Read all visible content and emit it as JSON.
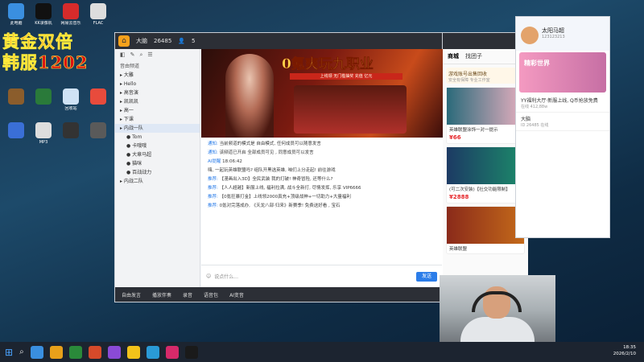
{
  "desktop": {
    "icons": [
      {
        "label": "此电脑",
        "color": "#3a8fe0"
      },
      {
        "label": "KK录像机",
        "color": "#111"
      },
      {
        "label": "网易云音乐",
        "color": "#d62b2b"
      },
      {
        "label": "FLAC",
        "color": "#ddd"
      },
      {
        "label": "",
        "color": "#8b5d2c"
      },
      {
        "label": "",
        "color": "#2a7a3a"
      },
      {
        "label": "回收站",
        "color": "#cfe2f5"
      },
      {
        "label": "",
        "color": "#e84b3c"
      },
      {
        "label": "",
        "color": "#3a6fd6"
      },
      {
        "label": "MP3",
        "color": "#ddd"
      },
      {
        "label": "",
        "color": "#333"
      },
      {
        "label": "",
        "color": "#5a5a5a"
      }
    ]
  },
  "overlay": {
    "line1": "黄金双倍",
    "line2": "韩服1202"
  },
  "app": {
    "title": "大脑",
    "count": "26485",
    "online": "5",
    "left_tools": [
      "◧",
      "✎",
      "⌕",
      "☰"
    ],
    "sort_label": "音由频道",
    "channels": [
      {
        "name": "大雕",
        "sub": false,
        "sel": false
      },
      {
        "name": "Hello",
        "sub": false,
        "sel": false
      },
      {
        "name": "高音演",
        "sub": false,
        "sel": false
      },
      {
        "name": "凯凯凯",
        "sub": false,
        "sel": false
      },
      {
        "name": "高一",
        "sub": false,
        "sel": false
      },
      {
        "name": "下课",
        "sub": false,
        "sel": false
      },
      {
        "name": "内战一队",
        "sub": false,
        "sel": true
      },
      {
        "name": "Tom",
        "sub": true,
        "sel": false
      },
      {
        "name": "卡哦哦",
        "sub": true,
        "sel": false
      },
      {
        "name": "大章马超",
        "sub": true,
        "sel": false
      },
      {
        "name": "猫咪",
        "sub": true,
        "sel": false
      },
      {
        "name": "百战战力",
        "sub": true,
        "sel": false
      },
      {
        "name": "内战二队",
        "sub": false,
        "sel": false
      }
    ],
    "banner_title": "0氪爽玩九职业",
    "banner_sub": "上线领  无门槛抽奖  充值 亿元",
    "chat": [
      {
        "tag": "通知:",
        "text": "当前频道的模式是 自由模式, 任何成员可以随意发言"
      },
      {
        "tag": "通知:",
        "text": "该频道已开启 全部成员可见 , 同意成员可以发言"
      },
      {
        "tag": "AI提醒",
        "text": "18:06:42"
      },
      {
        "tag": "",
        "text": "嗨, 一起玩英雄联盟吗? 组队开黑选英雄, 咱们上分走起! 前往游戏"
      },
      {
        "tag": "推荐:",
        "text": "【漫画出入3D】全民武装 我的打破! 神奇冒险, 还等什么?"
      },
      {
        "tag": "推荐:",
        "text": "【人人超越】新服上线, 福利拉满, 战斗全新打, 尽情发挥, 乐享 VIP6666"
      },
      {
        "tag": "推荐:",
        "text": "【0氪狂暴打金】上线领2000真充+顶级战神+一切助力+大量福利"
      },
      {
        "tag": "推荐:",
        "text": "0氪对完落成办, 《天龙八部·归来》新赛季! 免费送好看 , 宝石"
      }
    ],
    "input_placeholder": "说点什么...",
    "send_label": "发送",
    "bottom_items": [
      "自由发言",
      "播放伴奏",
      "录音",
      "语音包",
      "AI变音"
    ]
  },
  "store": {
    "tabs": [
      "商城",
      "找团子"
    ],
    "gift_title": "游戏账号出售回收",
    "gift_sub": "安全有保障 专业工作室",
    "cards": [
      {
        "title": "英雄联盟涂饰一对一提示",
        "price": "¥66",
        "color1": "#2a6a7a",
        "color2": "#e8b0c0"
      },
      {
        "title": "(可二次安装)【社交功能限制】",
        "price": "¥2888",
        "color1": "#1c3a64",
        "color2": "#1c8a6a"
      },
      {
        "title": "英雄联盟",
        "price": "",
        "color1": "#8a2a1a",
        "color2": "#c46a1a"
      }
    ]
  },
  "social": {
    "name": "太阳马超",
    "id": "123123213",
    "banner": "精彩世界",
    "rows": [
      {
        "title": "YY福利大厅·新服上线, Q币抢放免费",
        "sub": "在线 412,88w"
      },
      {
        "title": "大脑",
        "sub": "ID 26485 在线"
      }
    ]
  },
  "taskbar": {
    "time": "18:35",
    "date": "2026/2/10",
    "items": [
      "#3a8fe0",
      "#e8a01a",
      "#2a8a3a",
      "#d64a2a",
      "#8a4ad6",
      "#f2c21a",
      "#2a9ad6",
      "#d62a6a",
      "#1a1a1a"
    ]
  }
}
